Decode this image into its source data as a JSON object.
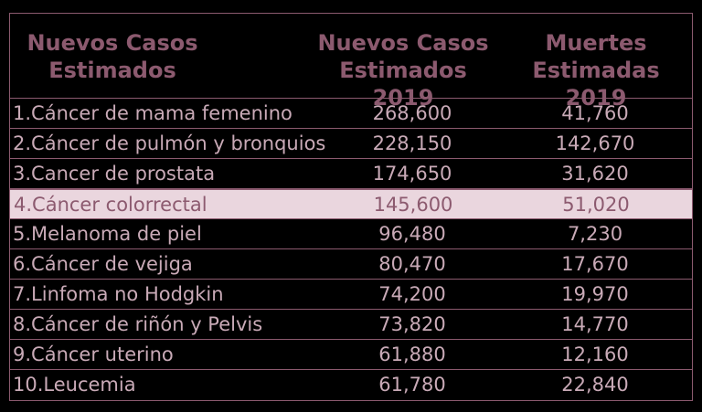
{
  "header": {
    "col1": "Nuevos Casos\nEstimados",
    "col2": "Nuevos Casos\nEstimados 2019",
    "col3": "Muertes\nEstimadas 2019"
  },
  "rows": [
    {
      "name": "1.Cáncer de mama femenino",
      "cases": "268,600",
      "deaths": "41,760"
    },
    {
      "name": "2.Cáncer de pulmón y bronquios",
      "cases": "228,150",
      "deaths": "142,670"
    },
    {
      "name": "3.Cancer de prostata",
      "cases": "174,650",
      "deaths": "31,620"
    },
    {
      "name": "4.Cáncer colorrectal",
      "cases": "145,600",
      "deaths": "51,020"
    },
    {
      "name": "5.Melanoma de piel",
      "cases": "96,480",
      "deaths": "7,230"
    },
    {
      "name": "6.Cáncer de vejiga",
      "cases": "80,470",
      "deaths": "17,670"
    },
    {
      "name": "7.Linfoma no Hodgkin",
      "cases": "74,200",
      "deaths": "19,970"
    },
    {
      "name": "8.Cáncer de riñón y Pelvis",
      "cases": "73,820",
      "deaths": "14,770"
    },
    {
      "name": "9.Cáncer uterino",
      "cases": "61,880",
      "deaths": "12,160"
    },
    {
      "name": "10.Leucemia",
      "cases": "61,780",
      "deaths": "22,840"
    }
  ],
  "colors": {
    "background": "#000000",
    "accent": "#8c5a6f",
    "text": "#c9aab7",
    "highlight": "#ead6de"
  }
}
